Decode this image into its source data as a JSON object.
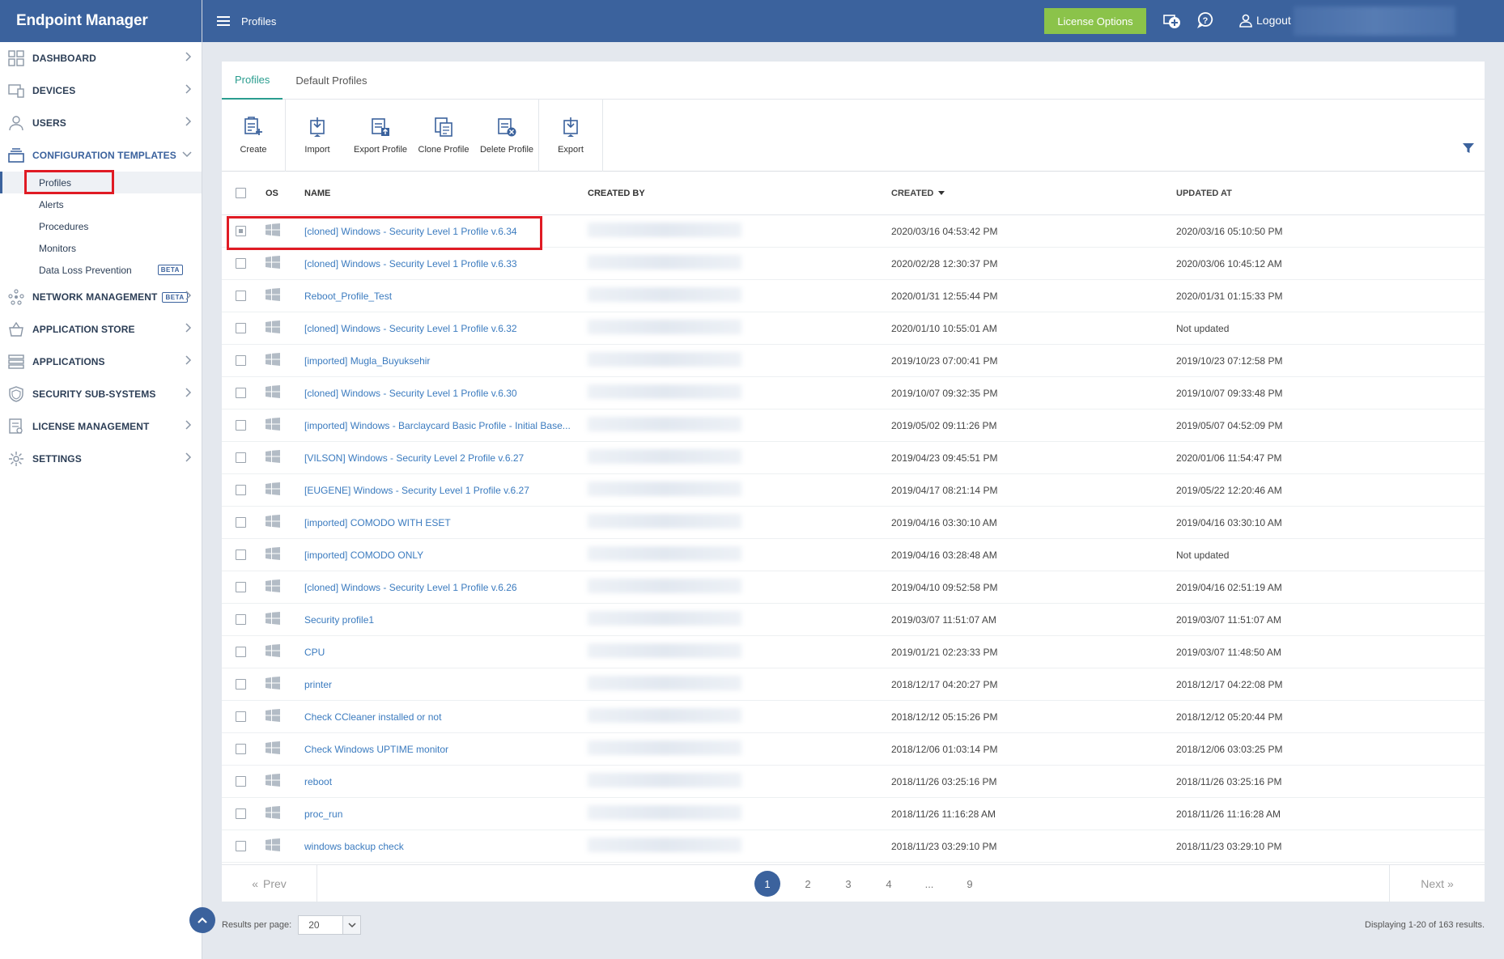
{
  "app": {
    "title": "Endpoint Manager"
  },
  "topbar": {
    "page_title": "Profiles",
    "license_button": "License Options",
    "logout": "Logout"
  },
  "sidebar": {
    "items": [
      {
        "label": "DASHBOARD",
        "icon": "dashboard-icon"
      },
      {
        "label": "DEVICES",
        "icon": "devices-icon"
      },
      {
        "label": "USERS",
        "icon": "users-icon"
      },
      {
        "label": "CONFIGURATION TEMPLATES",
        "icon": "templates-icon"
      },
      {
        "label": "NETWORK MANAGEMENT",
        "icon": "network-icon",
        "badge": "BETA"
      },
      {
        "label": "APPLICATION STORE",
        "icon": "store-icon"
      },
      {
        "label": "APPLICATIONS",
        "icon": "applications-icon"
      },
      {
        "label": "SECURITY SUB-SYSTEMS",
        "icon": "shield-icon"
      },
      {
        "label": "LICENSE MANAGEMENT",
        "icon": "license-icon"
      },
      {
        "label": "SETTINGS",
        "icon": "gear-icon"
      }
    ],
    "sub_items": [
      {
        "label": "Profiles"
      },
      {
        "label": "Alerts"
      },
      {
        "label": "Procedures"
      },
      {
        "label": "Monitors"
      },
      {
        "label": "Data Loss Prevention",
        "badge": "BETA"
      }
    ]
  },
  "tabs": [
    {
      "label": "Profiles"
    },
    {
      "label": "Default Profiles"
    }
  ],
  "toolbar": {
    "create": "Create",
    "import": "Import",
    "export_profile": "Export Profile",
    "clone_profile": "Clone Profile",
    "delete_profile": "Delete Profile",
    "export": "Export"
  },
  "table": {
    "headers": {
      "os": "OS",
      "name": "NAME",
      "created_by": "CREATED BY",
      "created": "CREATED",
      "updated_at": "UPDATED AT"
    },
    "rows": [
      {
        "name": "[cloned] Windows - Security Level 1 Profile v.6.34",
        "created": "2020/03/16 04:53:42 PM",
        "updated": "2020/03/16 05:10:50 PM"
      },
      {
        "name": "[cloned] Windows - Security Level 1 Profile v.6.33",
        "created": "2020/02/28 12:30:37 PM",
        "updated": "2020/03/06 10:45:12 AM"
      },
      {
        "name": "Reboot_Profile_Test",
        "created": "2020/01/31 12:55:44 PM",
        "updated": "2020/01/31 01:15:33 PM"
      },
      {
        "name": "[cloned] Windows - Security Level 1 Profile v.6.32",
        "created": "2020/01/10 10:55:01 AM",
        "updated": "Not updated"
      },
      {
        "name": "[imported] Mugla_Buyuksehir",
        "created": "2019/10/23 07:00:41 PM",
        "updated": "2019/10/23 07:12:58 PM"
      },
      {
        "name": "[cloned] Windows - Security Level 1 Profile v.6.30",
        "created": "2019/10/07 09:32:35 PM",
        "updated": "2019/10/07 09:33:48 PM"
      },
      {
        "name": "[imported] Windows - Barclaycard Basic Profile - Initial Base...",
        "created": "2019/05/02 09:11:26 PM",
        "updated": "2019/05/07 04:52:09 PM"
      },
      {
        "name": "[VILSON] Windows - Security Level 2 Profile v.6.27",
        "created": "2019/04/23 09:45:51 PM",
        "updated": "2020/01/06 11:54:47 PM"
      },
      {
        "name": "[EUGENE] Windows - Security Level 1 Profile v.6.27",
        "created": "2019/04/17 08:21:14 PM",
        "updated": "2019/05/22 12:20:46 AM"
      },
      {
        "name": "[imported] COMODO WITH ESET",
        "created": "2019/04/16 03:30:10 AM",
        "updated": "2019/04/16 03:30:10 AM"
      },
      {
        "name": "[imported] COMODO ONLY",
        "created": "2019/04/16 03:28:48 AM",
        "updated": "Not updated"
      },
      {
        "name": "[cloned] Windows - Security Level 1 Profile v.6.26",
        "created": "2019/04/10 09:52:58 PM",
        "updated": "2019/04/16 02:51:19 AM"
      },
      {
        "name": "Security profile1",
        "created": "2019/03/07 11:51:07 AM",
        "updated": "2019/03/07 11:51:07 AM"
      },
      {
        "name": "CPU",
        "created": "2019/01/21 02:23:33 PM",
        "updated": "2019/03/07 11:48:50 AM"
      },
      {
        "name": "printer",
        "created": "2018/12/17 04:20:27 PM",
        "updated": "2018/12/17 04:22:08 PM"
      },
      {
        "name": "Check CCleaner installed or not",
        "created": "2018/12/12 05:15:26 PM",
        "updated": "2018/12/12 05:20:44 PM"
      },
      {
        "name": "Check Windows UPTIME monitor",
        "created": "2018/12/06 01:03:14 PM",
        "updated": "2018/12/06 03:03:25 PM"
      },
      {
        "name": "reboot",
        "created": "2018/11/26 03:25:16 PM",
        "updated": "2018/11/26 03:25:16 PM"
      },
      {
        "name": "proc_run",
        "created": "2018/11/26 11:16:28 AM",
        "updated": "2018/11/26 11:16:28 AM"
      },
      {
        "name": "windows backup check",
        "created": "2018/11/23 03:29:10 PM",
        "updated": "2018/11/23 03:29:10 PM"
      }
    ]
  },
  "pagination": {
    "prev": "Prev",
    "next": "Next",
    "pages": [
      "1",
      "2",
      "3",
      "4",
      "...",
      "9"
    ],
    "current": "1"
  },
  "footer": {
    "results_per_page_label": "Results per page:",
    "results_per_page_value": "20",
    "displaying": "Displaying 1-20 of 163 results."
  },
  "colors": {
    "brand": "#3b629d",
    "accent": "#2a9d8f",
    "license": "#8bc34a",
    "link": "#3b7bbf"
  }
}
